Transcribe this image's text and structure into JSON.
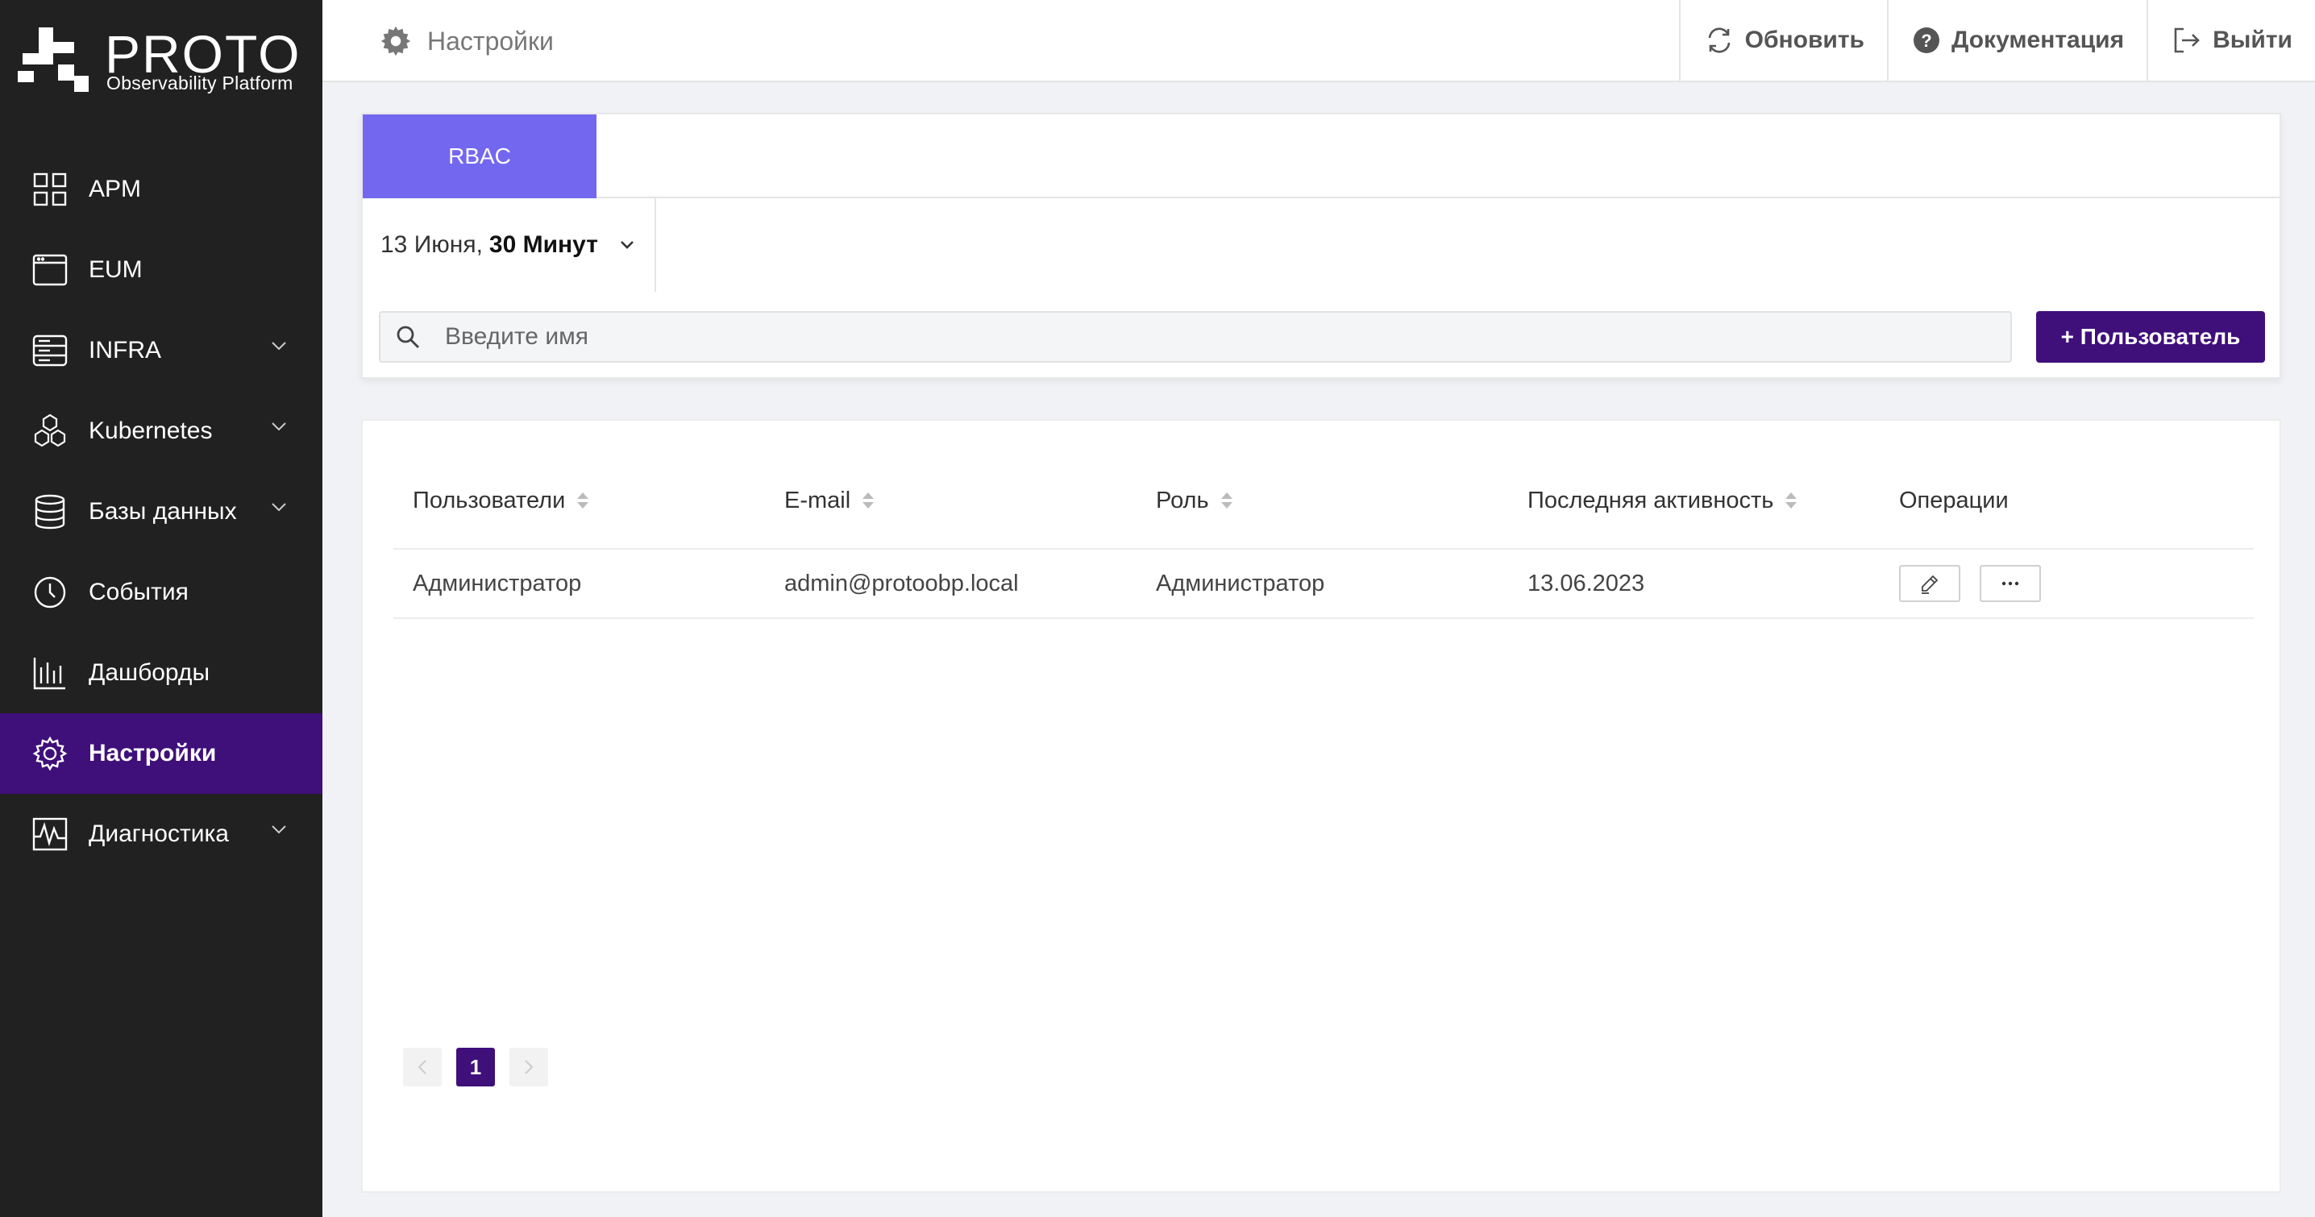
{
  "brand": {
    "name": "PROTO",
    "subtitle": "Observability Platform"
  },
  "sidebar": {
    "items": [
      {
        "label": "APM",
        "icon": "grid-icon",
        "expandable": false,
        "active": false
      },
      {
        "label": "EUM",
        "icon": "browser-window-icon",
        "expandable": false,
        "active": false
      },
      {
        "label": "INFRA",
        "icon": "server-icon",
        "expandable": true,
        "active": false
      },
      {
        "label": "Kubernetes",
        "icon": "hexagons-icon",
        "expandable": true,
        "active": false
      },
      {
        "label": "Базы данных",
        "icon": "database-icon",
        "expandable": true,
        "active": false
      },
      {
        "label": "События",
        "icon": "clock-icon",
        "expandable": false,
        "active": false
      },
      {
        "label": "Дашборды",
        "icon": "bar-chart-icon",
        "expandable": false,
        "active": false
      },
      {
        "label": "Настройки",
        "icon": "gear-icon",
        "expandable": false,
        "active": true
      },
      {
        "label": "Диагностика",
        "icon": "activity-icon",
        "expandable": true,
        "active": false
      }
    ]
  },
  "header": {
    "title": "Настройки",
    "refresh_label": "Обновить",
    "docs_label": "Документация",
    "logout_label": "Выйти"
  },
  "tabs": [
    {
      "label": "RBAC",
      "active": true
    }
  ],
  "date_picker": {
    "date": "13 Июня,",
    "range": "30 Минут"
  },
  "search": {
    "placeholder": "Введите имя",
    "value": ""
  },
  "add_user_label": "+ Пользователь",
  "table": {
    "columns": [
      "Пользователи",
      "E-mail",
      "Роль",
      "Последняя активность",
      "Операции"
    ],
    "rows": [
      {
        "user": "Администратор",
        "email": "admin@protoobp.local",
        "role": "Администратор",
        "last_activity": "13.06.2023"
      }
    ]
  },
  "pagination": {
    "current": "1"
  },
  "colors": {
    "accent": "#3f0f7a",
    "tab": "#7367f0",
    "sidebar": "#212121"
  }
}
